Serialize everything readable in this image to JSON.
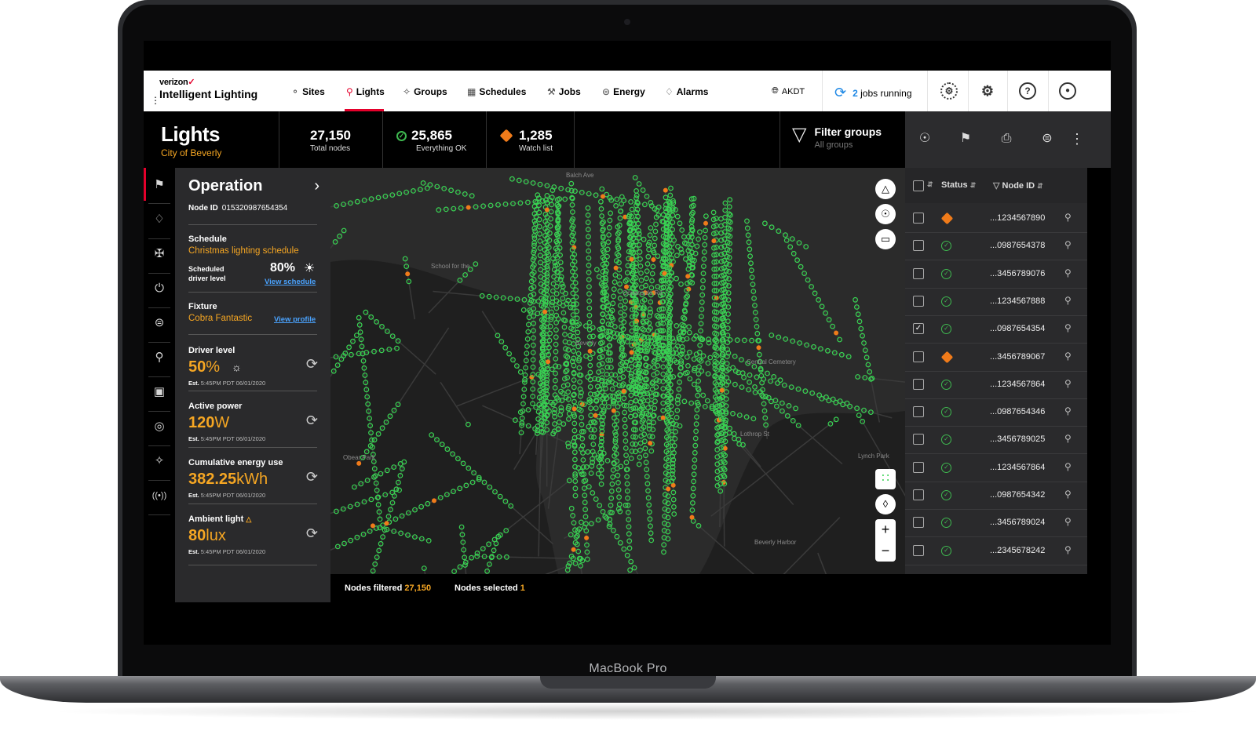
{
  "device": {
    "label": "MacBook Pro"
  },
  "nav": {
    "brand_top": "verizon",
    "brand_check": "✓",
    "brand_name": "Intelligent Lighting",
    "items": [
      {
        "label": "Sites",
        "icon": "sites-icon"
      },
      {
        "label": "Lights",
        "icon": "light-pin-icon",
        "active": true
      },
      {
        "label": "Groups",
        "icon": "groups-icon"
      },
      {
        "label": "Schedules",
        "icon": "schedules-icon"
      },
      {
        "label": "Jobs",
        "icon": "jobs-icon"
      },
      {
        "label": "Energy",
        "icon": "energy-icon"
      },
      {
        "label": "Alarms",
        "icon": "alarm-icon"
      }
    ],
    "timezone": "AKDT",
    "jobs_count": "2",
    "jobs_text": "jobs running",
    "accent": "#e4002b"
  },
  "header": {
    "title": "Lights",
    "subtitle": "City of Beverly",
    "stats": [
      {
        "value": "27,150",
        "label": "Total nodes"
      },
      {
        "value": "25,865",
        "label": "Everything OK"
      },
      {
        "value": "1,285",
        "label": "Watch list"
      }
    ],
    "filter": {
      "title": "Filter groups",
      "sub": "All groups"
    }
  },
  "operation": {
    "title": "Operation",
    "node_label": "Node ID",
    "node_id": "015320987654354",
    "schedule": {
      "label": "Schedule",
      "name": "Christmas lighting schedule",
      "driver_label_1": "Scheduled",
      "driver_label_2": "driver level",
      "level": "80%",
      "link": "View schedule"
    },
    "fixture": {
      "label": "Fixture",
      "name": "Cobra Fantastic",
      "link": "View profile"
    },
    "readings": [
      {
        "label": "Driver level",
        "value": "50",
        "unit": "%",
        "est_b": "Est.",
        "est": "5:45PM PDT 06/01/2020"
      },
      {
        "label": "Active power",
        "value": "120",
        "unit": "W",
        "est_b": "Est.",
        "est": "5:45PM PDT 06/01/2020"
      },
      {
        "label": "Cumulative energy use",
        "value": "382.25",
        "unit": "kWh",
        "est_b": "Est.",
        "est": "5:45PM PDT 06/01/2020"
      },
      {
        "label": "Ambient light",
        "value": "80",
        "unit": "lux",
        "est_b": "Est.",
        "est": "5:45PM PDT 06/01/2020"
      }
    ]
  },
  "map_labels": [
    "Balch Ave",
    "School for the",
    "Oceanside Rd",
    "Central Cemetery",
    "Beverly",
    "Obear Park",
    "Lothrop St",
    "Lynch Park",
    "Beverly Harbor"
  ],
  "footer": {
    "filtered_label": "Nodes filtered",
    "filtered_value": "27,150",
    "selected_label": "Nodes selected",
    "selected_value": "1"
  },
  "list": {
    "col_status": "Status",
    "col_node": "Node ID",
    "rows": [
      {
        "status": "warn",
        "id": "...1234567890",
        "checked": false
      },
      {
        "status": "ok",
        "id": "...0987654378",
        "checked": false
      },
      {
        "status": "ok",
        "id": "...3456789076",
        "checked": false
      },
      {
        "status": "ok",
        "id": "...1234567888",
        "checked": false
      },
      {
        "status": "ok",
        "id": "...0987654354",
        "checked": true
      },
      {
        "status": "warn",
        "id": "...3456789067",
        "checked": false
      },
      {
        "status": "ok",
        "id": "...1234567864",
        "checked": false
      },
      {
        "status": "ok",
        "id": "...0987654346",
        "checked": false
      },
      {
        "status": "ok",
        "id": "...3456789025",
        "checked": false
      },
      {
        "status": "ok",
        "id": "...1234567864",
        "checked": false
      },
      {
        "status": "ok",
        "id": "...0987654342",
        "checked": false
      },
      {
        "status": "ok",
        "id": "...3456789024",
        "checked": false
      },
      {
        "status": "ok",
        "id": "...2345678242",
        "checked": false
      }
    ]
  },
  "colors": {
    "ok": "#3fb950",
    "warn": "#f07b1a",
    "orange_text": "#f5a623",
    "link": "#4aa3ff",
    "node": "#39d353"
  }
}
